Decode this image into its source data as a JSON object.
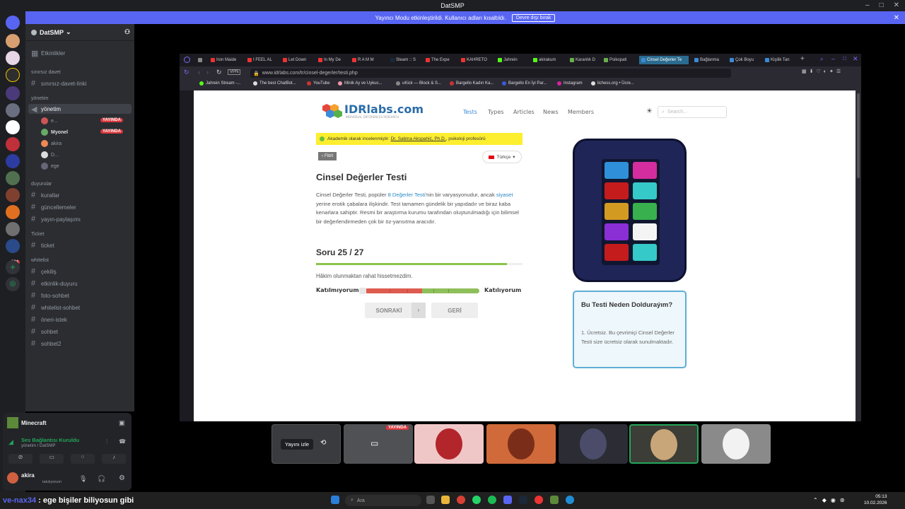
{
  "discord": {
    "title": "DatSMP",
    "streamer_notice": "Yayıncı Modu etkinleştirildi. Kullanıcı adları kısaltıldı.",
    "streamer_disable": "Devre dışı bırak",
    "server_name": "DatSMP",
    "events": "Etkinlikler",
    "categories": {
      "c1": "sınırsız davet",
      "c2": "yönetim",
      "c3": "duyurular",
      "c4": "Ticket",
      "c5": "whitelist"
    },
    "channels": {
      "invite": "sınırsız-davet-linki",
      "yonetim": "yönetim",
      "kurallar": "kurallar",
      "guncellemeler": "güncellemeler",
      "yayin": "yayın-paylaşımı",
      "ticket": "ticket",
      "cekilis": "çekiliş",
      "etkinlik": "etkinlik-duyuru",
      "foto": "foto-sohbet",
      "whitelist": "whitelist-sohbet",
      "oneri": "öneri-istek",
      "sohbet": "sohbet",
      "sohbet2": "sohbet2"
    },
    "voice_members": [
      "e...",
      "Myonel",
      "akira",
      "D...",
      "ege"
    ],
    "live_badge": "YAYINDA",
    "activity": "Minecraft",
    "voice_status": "Ses Bağlantısı Kuruldu",
    "voice_location": "yönetim / DatSMP",
    "user_name": "akira",
    "user_status": "takılıyorum",
    "watch_stream": "Yayını izle",
    "badge_count": "394"
  },
  "browser": {
    "tabs": [
      "Iron Maide",
      "I FEEL AL",
      "Let Down",
      "In My De",
      "R A M M",
      "Steam :: S",
      "The Expe",
      "KAHRETO",
      "Jahrein",
      "akirakum",
      "Karanlık D",
      "Psikopati",
      "Cinsel Değerler Te",
      "Bağlanma",
      "Çok Boyu",
      "Kişilik Tan"
    ],
    "url": "www.idrlabs.com/tr/cinsel-degerler/testi.php",
    "bookmarks": [
      "Jahrein Stream -...",
      "The best ChatBot...",
      "YouTube",
      "Minik Ay ve Uykuc...",
      "uKick — Block & S...",
      "Bargello Kadın Ka...",
      "Bargello En İyi Par...",
      "Instagram",
      "lichess.org • Ücre..."
    ]
  },
  "page": {
    "logo": "IDRlabs.com",
    "logo_sub": "INDIVIDUAL DIFFERENCES RESEARCH",
    "nav": [
      "Tests",
      "Types",
      "Articles",
      "News",
      "Members"
    ],
    "search_placeholder": "Search...",
    "banner_text": "Akademik olarak incelenmiştir: ",
    "banner_person": "Dr. Sabina Akspahić, Ph.D.",
    "banner_suffix": ", psikoloji profesörü",
    "crumb": "Flört",
    "language": "Türkçe",
    "title": "Cinsel Değerler Testi",
    "desc_1": "Cinsel Değerler Testi, popüler ",
    "desc_link1": "8 Değerler Testi",
    "desc_2": "'nin bir varyasyonudur, ancak ",
    "desc_link2": "siyaset",
    "desc_3": " yerine erotik çabalara ilişkindir. Test tamamen gündelik bir yapıdadır ve biraz kaba kenarlara sahiptir. Resmi bir araştırma kurumu tarafından oluşturulmadığı için bilimsel bir değerlendirmeden çok bir öz-yansıtma aracıdır.",
    "question_number": "Soru 25 / 27",
    "progress": 0.926,
    "question": "Hâkim olunmaktan rahat hissetmezdim.",
    "disagree": "Katılmıyorum",
    "agree": "Katılıyorum",
    "next": "SONRAKİ",
    "back": "GERİ",
    "info_title": "Bu Testi Neden Dolduraýım?",
    "info_body": "1. Ücretsiz. Bu çevrimiçi Cinsel Değerler Testi size ücretsiz olarak sunulmaktadır."
  },
  "taskbar": {
    "chat_user": "ve-nax34",
    "chat_text": " : ege bişiler biliyosun gibi",
    "search": "Ara",
    "time": "05:13",
    "date": "10.02.2026"
  }
}
